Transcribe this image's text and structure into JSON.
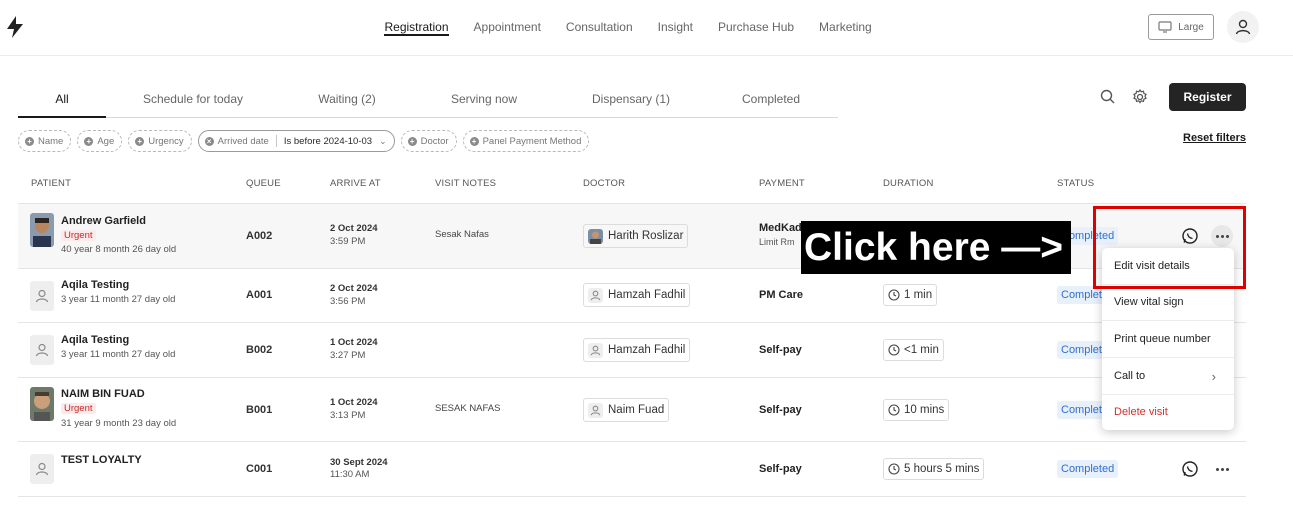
{
  "nav": {
    "items": [
      "Registration",
      "Appointment",
      "Consultation",
      "Insight",
      "Purchase Hub",
      "Marketing"
    ],
    "active": "Registration",
    "size_label": "Large"
  },
  "tabs": [
    "All",
    "Schedule for today",
    "Waiting (2)",
    "Serving now",
    "Dispensary (1)",
    "Completed"
  ],
  "register_label": "Register",
  "filters": {
    "name": "Name",
    "age": "Age",
    "urgency": "Urgency",
    "arrived_label": "Arrived date",
    "arrived_value": "Is before 2024-10-03",
    "doctor": "Doctor",
    "panel": "Panel Payment Method",
    "reset": "Reset filters"
  },
  "columns": [
    "PATIENT",
    "QUEUE",
    "ARRIVE AT",
    "VISIT NOTES",
    "DOCTOR",
    "PAYMENT",
    "DURATION",
    "STATUS"
  ],
  "rows": [
    {
      "name": "Andrew Garfield",
      "urgent": "Urgent",
      "age": "40 year 8 month 26 day old",
      "queue": "A002",
      "date": "2 Oct 2024",
      "time": "3:59 PM",
      "notes": "Sesak Nafas",
      "doctor": "Harith Roslizar",
      "payment": "MedKad",
      "payment_sub": "Limit Rm",
      "duration": "",
      "status": "Completed"
    },
    {
      "name": "Aqila Testing",
      "urgent": "",
      "age": "3 year 11 month 27 day old",
      "queue": "A001",
      "date": "2 Oct 2024",
      "time": "3:56 PM",
      "notes": "",
      "doctor": "Hamzah Fadhil",
      "payment": "PM Care",
      "payment_sub": "",
      "duration": "1 min",
      "status": "Completed"
    },
    {
      "name": "Aqila Testing",
      "urgent": "",
      "age": "3 year 11 month 27 day old",
      "queue": "B002",
      "date": "1 Oct 2024",
      "time": "3:27 PM",
      "notes": "",
      "doctor": "Hamzah Fadhil",
      "payment": "Self-pay",
      "payment_sub": "",
      "duration": "<1 min",
      "status": "Completed"
    },
    {
      "name": "NAIM BIN FUAD",
      "urgent": "Urgent",
      "age": "31 year 9 month 23 day old",
      "queue": "B001",
      "date": "1 Oct 2024",
      "time": "3:13 PM",
      "notes": "SESAK NAFAS",
      "doctor": "Naim Fuad",
      "payment": "Self-pay",
      "payment_sub": "",
      "duration": "10 mins",
      "status": "Completed"
    },
    {
      "name": "TEST LOYALTY",
      "urgent": "",
      "age": "",
      "queue": "C001",
      "date": "30 Sept 2024",
      "time": "11:30 AM",
      "notes": "",
      "doctor": "",
      "payment": "Self-pay",
      "payment_sub": "",
      "duration": "5 hours 5 mins",
      "status": "Completed"
    }
  ],
  "menu": {
    "items": [
      "Edit visit details",
      "View vital sign",
      "Print queue number",
      "Call to",
      "Delete visit"
    ]
  },
  "annotation": "Click here —>",
  "colors": {
    "accent": "#1a1a1a",
    "status_bg": "#e8f0fb",
    "status_text": "#2e6fd1",
    "urgent": "#c62828",
    "highlight_box": "#e00000"
  }
}
